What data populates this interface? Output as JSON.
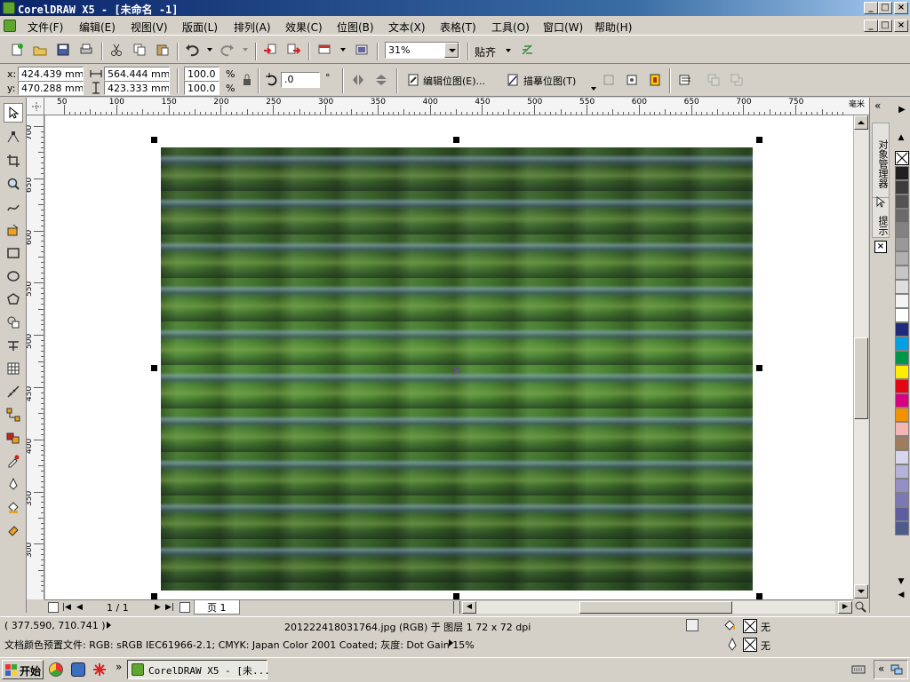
{
  "window": {
    "title": "CorelDRAW X5 - [未命名 -1]",
    "controls": [
      "_",
      "□",
      "×"
    ],
    "doc_controls": [
      "_",
      "□",
      "×"
    ]
  },
  "menu": [
    "文件(F)",
    "编辑(E)",
    "视图(V)",
    "版面(L)",
    "排列(A)",
    "效果(C)",
    "位图(B)",
    "文本(X)",
    "表格(T)",
    "工具(O)",
    "窗口(W)",
    "帮助(H)"
  ],
  "toolbar": {
    "zoom": "31%",
    "snap_label": "贴齐"
  },
  "property_bar": {
    "x_label": "x:",
    "x_value": "424.439 mm",
    "y_label": "y:",
    "y_value": "470.288 mm",
    "width_value": "564.444 mm",
    "height_value": "423.333 mm",
    "scale_x": "100.0",
    "scale_y": "100.0",
    "percent": "%",
    "rotation": ".0",
    "degree": "°",
    "edit_bitmap": "编辑位图(E)...",
    "trace_bitmap": "描摹位图(T)"
  },
  "rulers": {
    "h_ticks": [
      "50",
      "100",
      "150",
      "200",
      "250",
      "300",
      "350",
      "400",
      "450",
      "500",
      "550",
      "600",
      "650",
      "700",
      "750"
    ],
    "h_unit": "毫米",
    "v_ticks": [
      "700",
      "650",
      "600",
      "550",
      "500",
      "450",
      "400",
      "350",
      "300"
    ]
  },
  "dockers": {
    "object_manager": "对象管理器",
    "hints": "提示"
  },
  "palette": {
    "none_label": "none",
    "colors": [
      "#231f20",
      "#3d3b3c",
      "#545253",
      "#6b6969",
      "#838181",
      "#9a9898",
      "#b1afaf",
      "#c7c6c6",
      "#dededd",
      "#f4f4f4",
      "#ffffff",
      "#1f2a7a",
      "#00a0e3",
      "#00964a",
      "#ffed00",
      "#e30613",
      "#d80082",
      "#f39200",
      "#f5b5b5",
      "#a07c5e",
      "#d8d6ec",
      "#b5b2d8",
      "#9490c3",
      "#7c78b5",
      "#5f5da1",
      "#4e5c8c"
    ]
  },
  "page_nav": {
    "counter": "1 / 1",
    "tab": "页 1"
  },
  "status": {
    "coords": "( 377.590, 710.741 )",
    "object_info": "201222418031764.jpg (RGB) 于 图层 1 72 x 72 dpi",
    "color_profile": "文档颜色预置文件: RGB: sRGB IEC61966-2.1; CMYK: Japan Color 2001 Coated; 灰度: Dot Gain 15%",
    "fill_none": "无",
    "outline_none": "无"
  },
  "taskbar": {
    "start": "开始",
    "task": "CorelDRAW X5 - [未..."
  }
}
